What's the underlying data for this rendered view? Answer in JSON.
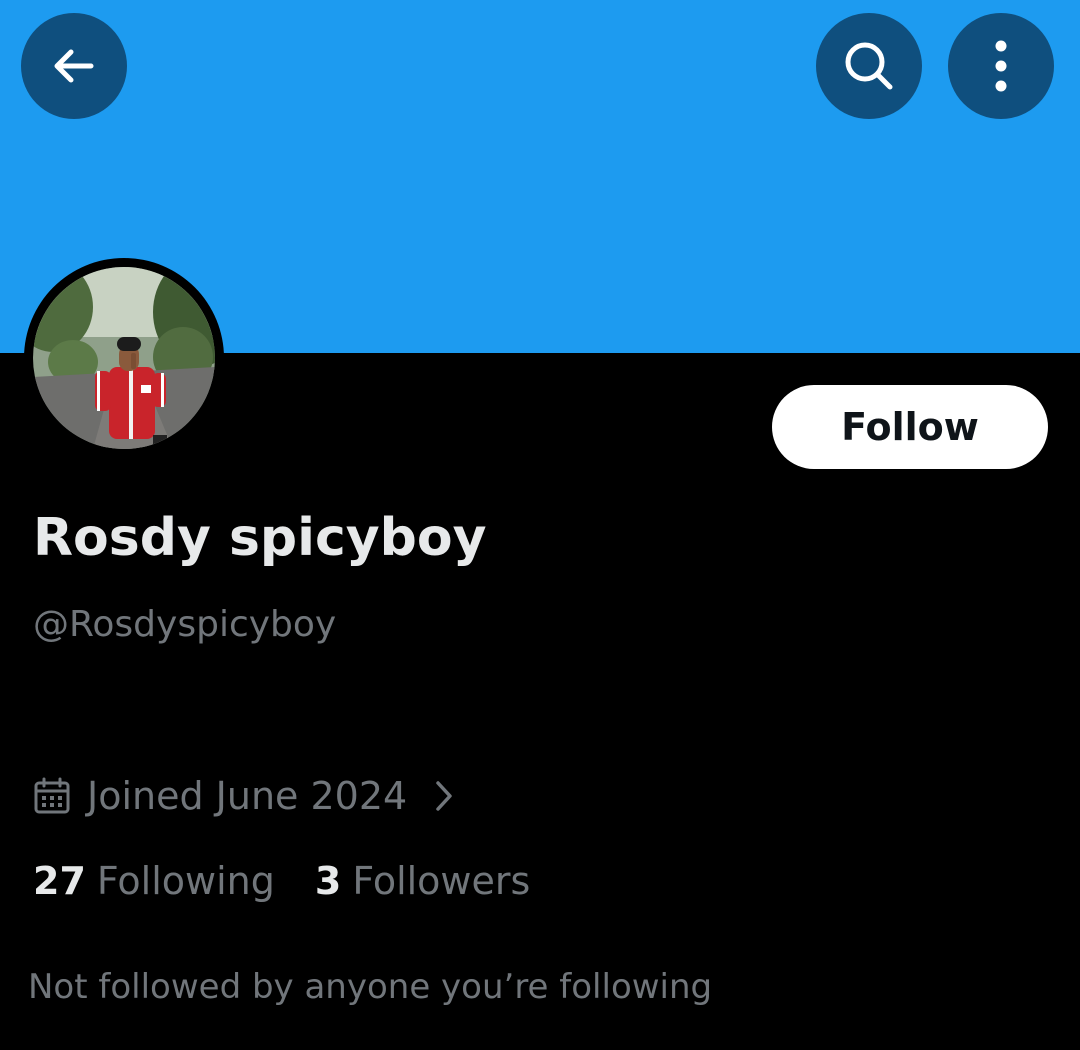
{
  "colors": {
    "banner": "#1d9bf0",
    "icon_button_bg": "#0f4f7e",
    "background": "#000000",
    "primary_text": "#e7e9ea",
    "secondary_text": "#71767b",
    "follow_button_bg": "#ffffff",
    "follow_button_text": "#0f1419"
  },
  "header": {
    "back_icon": "arrow-left-icon",
    "search_icon": "search-icon",
    "more_icon": "more-vertical-icon"
  },
  "profile": {
    "display_name": "Rosdy spicyboy",
    "handle": "@Rosdyspicyboy",
    "avatar_icon": "avatar-photo",
    "follow_label": "Follow",
    "joined_icon": "calendar-icon",
    "joined": "Joined June 2024",
    "joined_chevron_icon": "chevron-right-icon",
    "following_count": "27",
    "following_label": "Following",
    "followers_count": "3",
    "followers_label": "Followers",
    "not_followed_text": "Not followed by anyone you’re following"
  }
}
